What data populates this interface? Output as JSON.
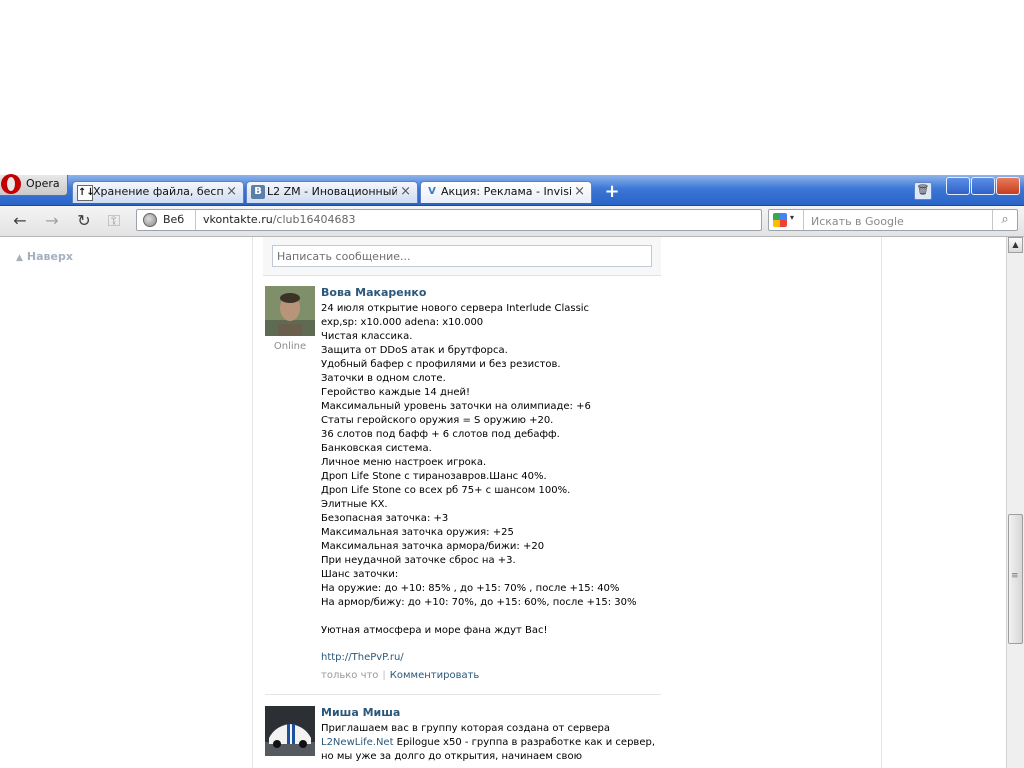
{
  "browser": {
    "menu_label": "Opera",
    "tabs": [
      {
        "icon": "↑↓",
        "title": "Хранение файла, беспл...",
        "close": "×"
      },
      {
        "icon": "B",
        "title": "L2 ZM - Иновационный I...",
        "close": "×"
      },
      {
        "icon": "V",
        "title": "Акция: Реклама - Invisi...",
        "close": "×"
      }
    ],
    "new_tab": "+",
    "trash": "🗑",
    "nav": {
      "back": "←",
      "forward": "→",
      "reload": "↻",
      "keys": "⚿"
    },
    "address": {
      "scheme_label": "Веб",
      "host": "vkontakte.ru",
      "path": "/club16404683"
    },
    "search": {
      "placeholder": "Искать в Google",
      "button": "⌕",
      "engine_caret": "▾"
    }
  },
  "page": {
    "back_to_top": {
      "arrow": "▲",
      "label": "Наверх"
    },
    "compose_placeholder": "Написать сообщение...",
    "posts": [
      {
        "author": "Вова Макаренко",
        "status": "Online",
        "text": "24 июля открытие нового сервера Interlude Classic\nexp,sp: x10.000 adena: x10.000\nЧистая классика.\nЗащита от DDoS атак и брутфорса.\nУдобный бафер с профилями и без резистов.\nЗаточки в одном слоте.\nГеройство каждые 14 дней!\nМаксимальный уровень заточки на олимпиаде: +6\nСтаты геройского оружия = S оружию +20.\n36 слотов под бафф + 6 слотов под дебафф.\nБанковская система.\nЛичное меню настроек игрока.\nДроп Life Stone с тиранозавров.Шанс 40%.\nДроп Life Stone со всех рб 75+ с шансом 100%.\nЭлитные КХ.\nБезопасная заточка: +3\nМаксимальная заточка оружия: +25\nМаксимальная заточка армора/бижи: +20\nПри неудачной заточке сброс на +3.\nШанс заточки:\nНа оружие: до +10: 85% , до +15: 70% , после +15: 40%\nНа армор/бижу: до +10: 70%, до +15: 60%, после +15: 30%\n\nУютная атмосфера и море фана ждут Вас!",
        "link": "http://ThePvP.ru/",
        "time": "только что",
        "meta_sep": "|",
        "comment_label": "Комментировать"
      },
      {
        "author": "Миша Миша",
        "text_before_link": "Приглашаем вас в группу которая создана от сервера ",
        "link": "L2NewLife.Net",
        "text_after_link": " Epilogue x50 - группа в разработке как и сервер, но мы уже за долго до открытия, начинаем свою"
      }
    ]
  },
  "scrollbar": {
    "up_arrow": "▲"
  }
}
